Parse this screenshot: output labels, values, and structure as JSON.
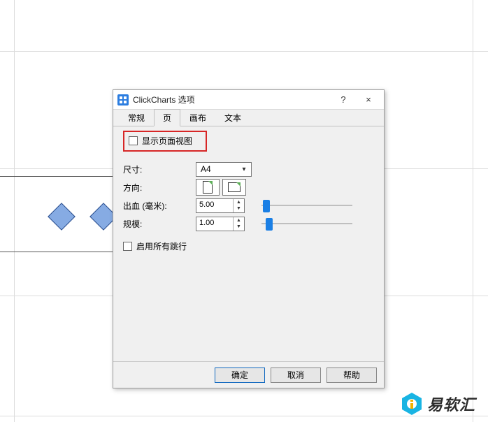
{
  "dialog": {
    "title": "ClickCharts 选项",
    "help_button": "?",
    "close_button": "×"
  },
  "tabs": {
    "general": "常规",
    "page": "页",
    "canvas": "画布",
    "text": "文本",
    "active": "page"
  },
  "page_options": {
    "show_page_view": "显示页面视图",
    "show_page_view_checked": false,
    "size_label": "尺寸:",
    "size_value": "A4",
    "orientation_label": "方向:",
    "bleed_label": "出血 (毫米):",
    "bleed_value": "5.00",
    "scale_label": "规模:",
    "scale_value": "1.00",
    "enable_jumps_label": "启用所有跳行",
    "enable_jumps_checked": false
  },
  "footer": {
    "ok": "确定",
    "cancel": "取消",
    "help": "帮助"
  },
  "watermark": {
    "text": "易软汇"
  }
}
